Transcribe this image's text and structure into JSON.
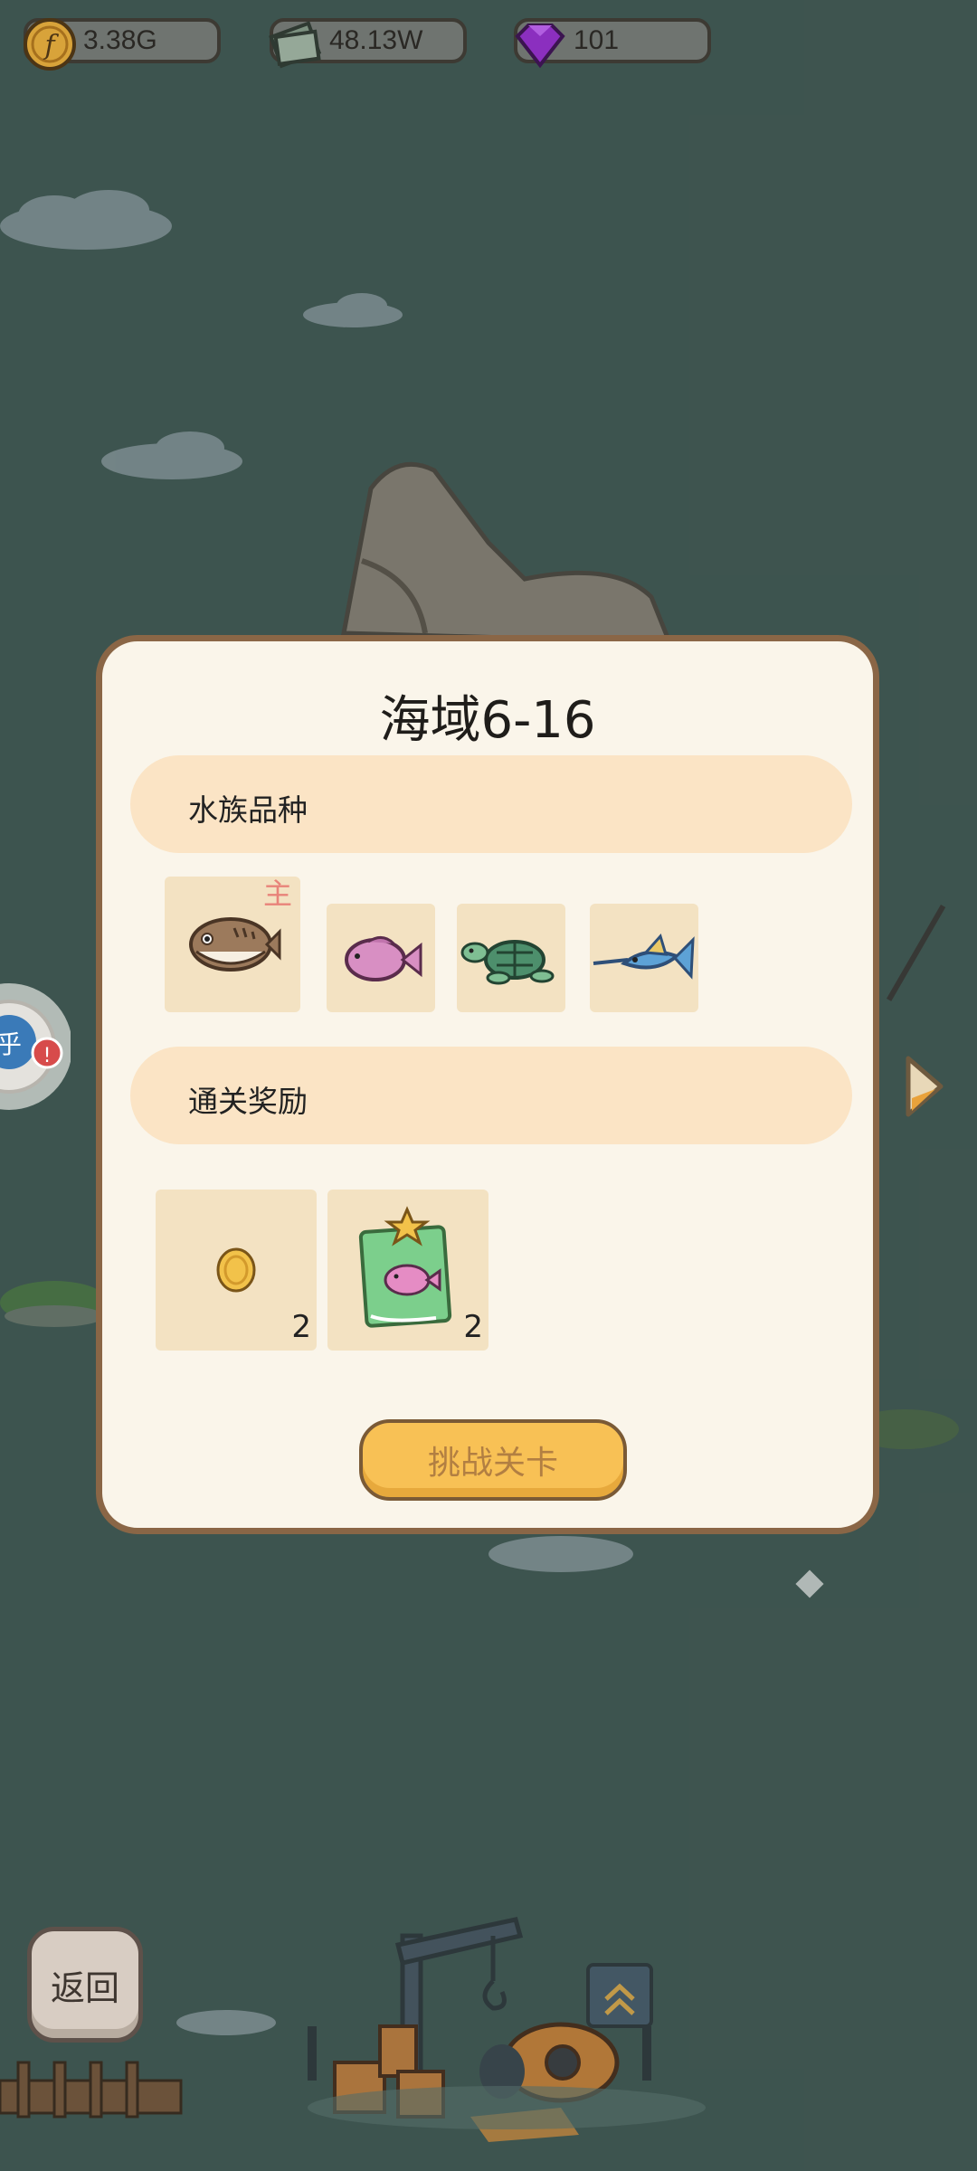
{
  "resources": [
    {
      "name": "coins",
      "value": "3.38G",
      "color": "#d8a33a"
    },
    {
      "name": "cash",
      "value": "48.13W",
      "color": "#7c9180"
    },
    {
      "name": "gems",
      "value": "101",
      "color": "#8b2fbf"
    }
  ],
  "modal": {
    "title": "海域6-16",
    "species_header": "水族品种",
    "main_tag": "主",
    "species": [
      {
        "icon": "pufferfish-icon",
        "is_main": true
      },
      {
        "icon": "pink-fish-icon",
        "is_main": false
      },
      {
        "icon": "sea-turtle-icon",
        "is_main": false
      },
      {
        "icon": "swordfish-icon",
        "is_main": false
      }
    ],
    "reward_header": "通关奖励",
    "rewards": [
      {
        "icon": "gold-coin-icon",
        "qty": "2"
      },
      {
        "icon": "fish-card-icon",
        "qty": "2"
      }
    ],
    "challenge_label": "挑战关卡"
  },
  "back_label": "返回",
  "side_avatar_text": "乎"
}
